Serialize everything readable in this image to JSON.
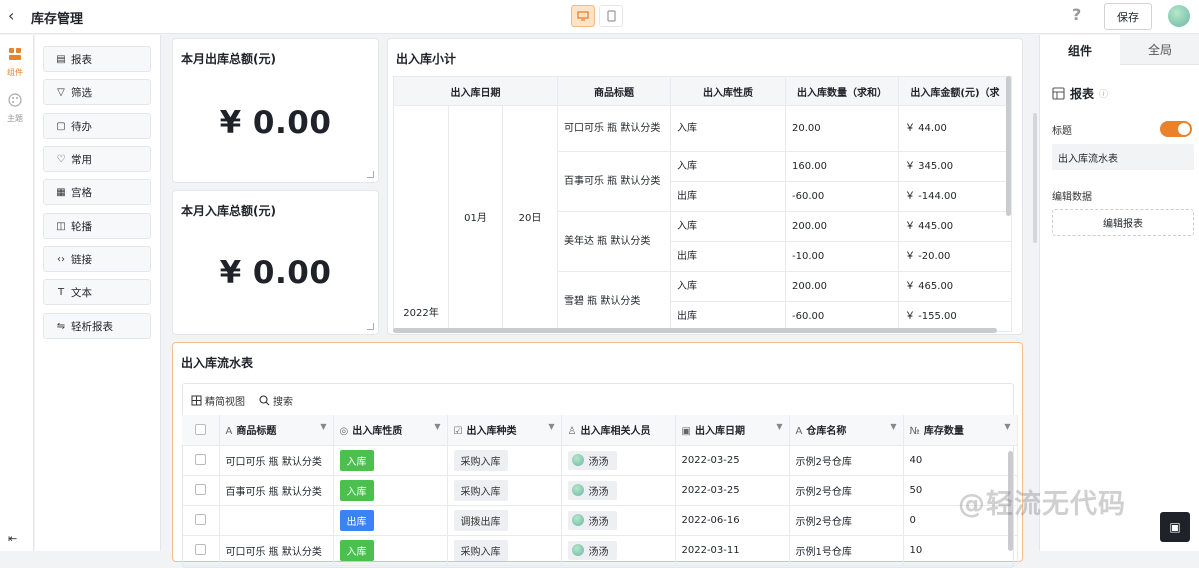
{
  "header": {
    "back_icon": "chevron-left-icon",
    "title": "库存管理",
    "help_icon": "question-icon",
    "save_label": "保存"
  },
  "rail": {
    "items": [
      {
        "label": "组件",
        "icon": "component-icon",
        "active": true
      },
      {
        "label": "主题",
        "icon": "palette-icon",
        "active": false
      }
    ]
  },
  "components": [
    {
      "label": "报表",
      "icon": "report-icon"
    },
    {
      "label": "筛选",
      "icon": "filter-icon"
    },
    {
      "label": "待办",
      "icon": "todo-icon"
    },
    {
      "label": "常用",
      "icon": "heart-icon"
    },
    {
      "label": "宫格",
      "icon": "grid-icon"
    },
    {
      "label": "轮播",
      "icon": "carousel-icon"
    },
    {
      "label": "链接",
      "icon": "link-icon"
    },
    {
      "label": "文本",
      "icon": "text-icon"
    },
    {
      "label": "轻析报表",
      "icon": "analysis-icon"
    }
  ],
  "stats": [
    {
      "title": "本月出库总额(元)",
      "value": "¥ 0.00"
    },
    {
      "title": "本月入库总额(元)",
      "value": "¥ 0.00"
    }
  ],
  "pivot": {
    "title": "出入库小计",
    "headers": [
      "出入库日期",
      "商品标题",
      "出入库性质",
      "出入库数量（求和）",
      "出入库金额(元)（求"
    ],
    "year": "2022年",
    "month": "01月",
    "day": "20日",
    "groups": [
      {
        "product": "可口可乐 瓶 默认分类",
        "rows": [
          {
            "nature": "入库",
            "qty": "20.00",
            "amount": "￥ 44.00"
          }
        ]
      },
      {
        "product": "百事可乐 瓶 默认分类",
        "rows": [
          {
            "nature": "入库",
            "qty": "160.00",
            "amount": "￥ 345.00"
          },
          {
            "nature": "出库",
            "qty": "-60.00",
            "amount": "￥ -144.00"
          }
        ]
      },
      {
        "product": "美年达 瓶 默认分类",
        "rows": [
          {
            "nature": "入库",
            "qty": "200.00",
            "amount": "￥ 445.00"
          },
          {
            "nature": "出库",
            "qty": "-10.00",
            "amount": "￥ -20.00"
          }
        ]
      },
      {
        "product": "雪碧 瓶 默认分类",
        "rows": [
          {
            "nature": "入库",
            "qty": "200.00",
            "amount": "￥ 465.00"
          },
          {
            "nature": "出库",
            "qty": "-60.00",
            "amount": "￥ -155.00"
          }
        ]
      }
    ]
  },
  "flow": {
    "title": "出入库流水表",
    "toolbar": {
      "view_label": "精简视图",
      "search_label": "搜索"
    },
    "columns": [
      {
        "label": "商品标题",
        "icon": "text-type-icon"
      },
      {
        "label": "出入库性质",
        "icon": "radio-type-icon"
      },
      {
        "label": "出入库种类",
        "icon": "checkbox-type-icon"
      },
      {
        "label": "出入库相关人员",
        "icon": "person-type-icon"
      },
      {
        "label": "出入库日期",
        "icon": "calendar-type-icon"
      },
      {
        "label": "仓库名称",
        "icon": "text-type-icon"
      },
      {
        "label": "库存数量",
        "icon": "number-type-icon"
      }
    ],
    "rows": [
      {
        "product": "可口可乐 瓶 默认分类",
        "nature": "入库",
        "kind": "采购入库",
        "person": "汤汤",
        "date": "2022-03-25",
        "warehouse": "示例2号仓库",
        "stock": "40"
      },
      {
        "product": "百事可乐 瓶 默认分类",
        "nature": "入库",
        "kind": "采购入库",
        "person": "汤汤",
        "date": "2022-03-25",
        "warehouse": "示例2号仓库",
        "stock": "50"
      },
      {
        "product": "",
        "nature": "出库",
        "kind": "调拨出库",
        "person": "汤汤",
        "date": "2022-06-16",
        "warehouse": "示例2号仓库",
        "stock": "0"
      },
      {
        "product": "可口可乐 瓶 默认分类",
        "nature": "入库",
        "kind": "采购入库",
        "person": "汤汤",
        "date": "2022-03-11",
        "warehouse": "示例1号仓库",
        "stock": "10"
      }
    ]
  },
  "props": {
    "tabs": [
      "组件",
      "全局"
    ],
    "section": "报表",
    "title_label": "标题",
    "title_value": "出入库流水表",
    "edit_data_label": "编辑数据",
    "edit_button": "编辑报表"
  },
  "watermark": "@轻流无代码",
  "colors": {
    "accent": "#e8822b",
    "in_tag": "#4cc04e",
    "out_tag": "#3b82f6"
  }
}
